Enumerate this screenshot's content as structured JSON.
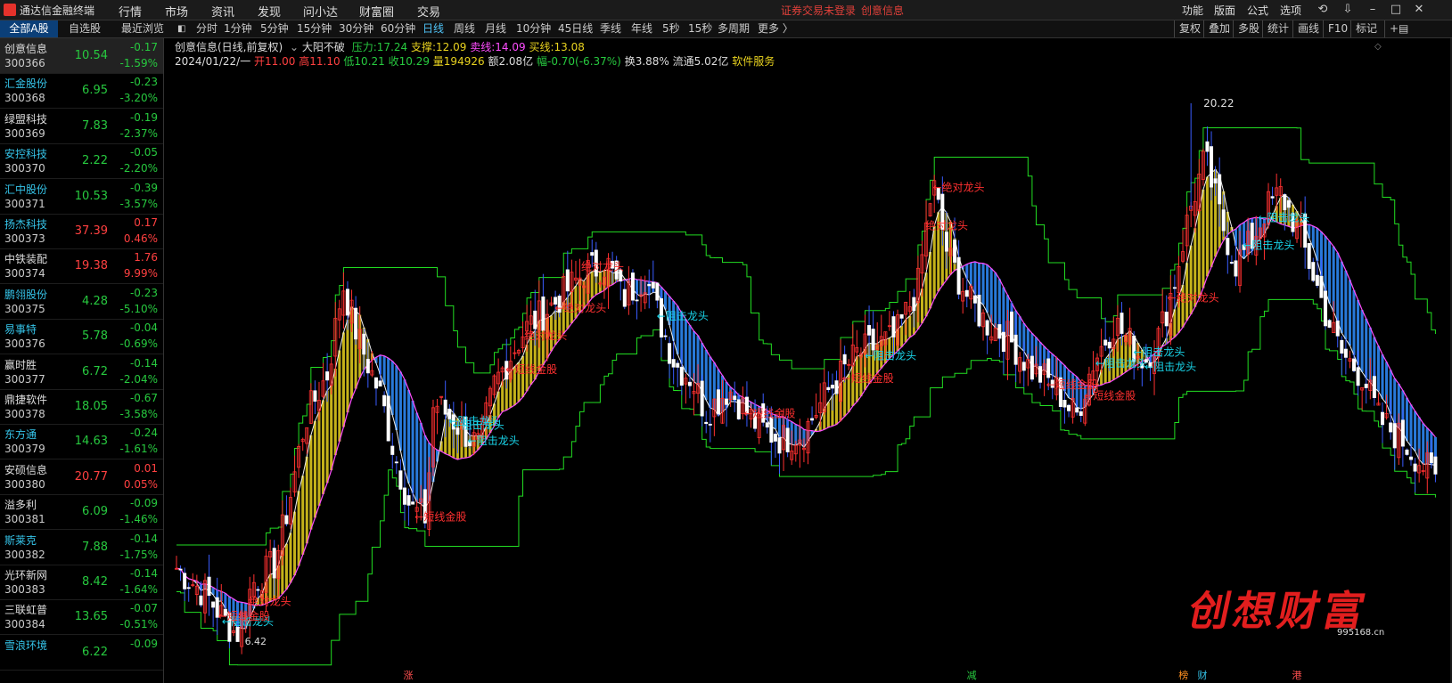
{
  "app": {
    "title": "通达信金融终端",
    "menus": [
      "行情",
      "市场",
      "资讯",
      "发现",
      "问小达",
      "财富圈",
      "交易"
    ],
    "status_login": "证券交易未登录",
    "status_stock": "创意信息",
    "right_menus": [
      "功能",
      "版面",
      "公式",
      "选项"
    ]
  },
  "list_tabs": [
    "全部A股",
    "自选股",
    "最近浏览"
  ],
  "period_tabs": [
    "分时",
    "1分钟",
    "5分钟",
    "15分钟",
    "30分钟",
    "60分钟",
    "日线",
    "周线",
    "月线",
    "10分钟",
    "45日线",
    "季线",
    "年线",
    "5秒",
    "15秒",
    "多周期",
    "更多 〉"
  ],
  "active_period": "日线",
  "right_tools": [
    "复权",
    "叠加",
    "多股",
    "统计",
    "画线",
    "F10",
    "标记"
  ],
  "stocks": [
    {
      "name": "创意信息",
      "code": "300366",
      "price": "10.54",
      "change": "-0.17",
      "pct": "-1.59%",
      "dir": "dn",
      "name_color": "#dddddd",
      "selected": true
    },
    {
      "name": "汇金股份",
      "code": "300368",
      "price": "6.95",
      "change": "-0.23",
      "pct": "-3.20%",
      "dir": "dn",
      "name_color": "#35c3e8"
    },
    {
      "name": "绿盟科技",
      "code": "300369",
      "price": "7.83",
      "change": "-0.19",
      "pct": "-2.37%",
      "dir": "dn",
      "name_color": "#dddddd"
    },
    {
      "name": "安控科技",
      "code": "300370",
      "price": "2.22",
      "change": "-0.05",
      "pct": "-2.20%",
      "dir": "dn",
      "name_color": "#35c3e8"
    },
    {
      "name": "汇中股份",
      "code": "300371",
      "price": "10.53",
      "change": "-0.39",
      "pct": "-3.57%",
      "dir": "dn",
      "name_color": "#35c3e8"
    },
    {
      "name": "扬杰科技",
      "code": "300373",
      "price": "37.39",
      "change": "0.17",
      "pct": "0.46%",
      "dir": "up",
      "name_color": "#35c3e8"
    },
    {
      "name": "中铁装配",
      "code": "300374",
      "price": "19.38",
      "change": "1.76",
      "pct": "9.99%",
      "dir": "up",
      "name_color": "#dddddd"
    },
    {
      "name": "鹏翎股份",
      "code": "300375",
      "price": "4.28",
      "change": "-0.23",
      "pct": "-5.10%",
      "dir": "dn",
      "name_color": "#35c3e8"
    },
    {
      "name": "易事特",
      "code": "300376",
      "price": "5.78",
      "change": "-0.04",
      "pct": "-0.69%",
      "dir": "dn",
      "name_color": "#35c3e8"
    },
    {
      "name": "赢时胜",
      "code": "300377",
      "price": "6.72",
      "change": "-0.14",
      "pct": "-2.04%",
      "dir": "dn",
      "name_color": "#dddddd"
    },
    {
      "name": "鼎捷软件",
      "code": "300378",
      "price": "18.05",
      "change": "-0.67",
      "pct": "-3.58%",
      "dir": "dn",
      "name_color": "#dddddd"
    },
    {
      "name": "东方通",
      "code": "300379",
      "price": "14.63",
      "change": "-0.24",
      "pct": "-1.61%",
      "dir": "dn",
      "name_color": "#35c3e8"
    },
    {
      "name": "安硕信息",
      "code": "300380",
      "price": "20.77",
      "change": "0.01",
      "pct": "0.05%",
      "dir": "up",
      "name_color": "#dddddd"
    },
    {
      "name": "溢多利",
      "code": "300381",
      "price": "6.09",
      "change": "-0.09",
      "pct": "-1.46%",
      "dir": "dn",
      "name_color": "#dddddd"
    },
    {
      "name": "斯莱克",
      "code": "300382",
      "price": "7.88",
      "change": "-0.14",
      "pct": "-1.75%",
      "dir": "dn",
      "name_color": "#35c3e8"
    },
    {
      "name": "光环新网",
      "code": "300383",
      "price": "8.42",
      "change": "-0.14",
      "pct": "-1.64%",
      "dir": "dn",
      "name_color": "#dddddd"
    },
    {
      "name": "三联虹普",
      "code": "300384",
      "price": "13.65",
      "change": "-0.07",
      "pct": "-0.51%",
      "dir": "dn",
      "name_color": "#dddddd"
    },
    {
      "name": "雪浪环境",
      "code": "",
      "price": "6.22",
      "change": "-0.09",
      "pct": "",
      "dir": "dn",
      "name_color": "#35c3e8"
    }
  ],
  "chart_header": {
    "name": "创意信息(日线,前复权)",
    "indicator": "大阳不破",
    "pressure_label": "压力:",
    "pressure": "17.24",
    "support_label": "支撑:",
    "support": "12.09",
    "sell_label": "卖线:",
    "sell": "14.09",
    "buy_label": "买线:",
    "buy": "13.08",
    "date": "2024/01/22/一",
    "open": "开11.00",
    "high": "高11.10",
    "low": "低10.21",
    "close": "收10.29",
    "volume": "量194926",
    "amount": "额2.08亿",
    "amplitude": "幅-0.70(-6.37%)",
    "turnover": "换3.88%",
    "float": "流通5.02亿",
    "sector": "软件服务"
  },
  "chart_labels": {
    "high_mark": "20.22",
    "low_mark": "6.42",
    "signals": [
      {
        "text": "←阻击龙头",
        "color": "#19d3e8",
        "xi": 12,
        "yp": 0.33
      },
      {
        "text": "绝对龙头",
        "color": "#ff3030",
        "xi": 19,
        "yp": 0.36
      },
      {
        "text": "←短线金股",
        "color": "#ff3030",
        "xi": 11,
        "yp": 0.03
      },
      {
        "text": "←短线金股",
        "color": "#ff3030",
        "xi": 63,
        "yp": 1.05
      },
      {
        "text": "←阻击龙头",
        "color": "#19d3e8",
        "xi": 72,
        "yp": 2.05
      },
      {
        "text": "←阻击龙头",
        "color": "#19d3e8",
        "xi": 73,
        "yp": 2.35
      },
      {
        "text": "←阻击龙头",
        "color": "#19d3e8",
        "xi": 77,
        "yp": 2.65
      },
      {
        "text": "←短线金股",
        "color": "#ff3030",
        "xi": 87,
        "yp": 3.5
      },
      {
        "text": "绝对龙头",
        "color": "#ff3030",
        "xi": 92,
        "yp": 4.3
      },
      {
        "text": "←绝对龙头",
        "color": "#ff3030",
        "xi": 100,
        "yp": 3.8
      },
      {
        "text": "绝对龙头",
        "color": "#ff3030",
        "xi": 107,
        "yp": 5.6
      },
      {
        "text": "←阻击龙头",
        "color": "#19d3e8",
        "xi": 127,
        "yp": 3.35
      },
      {
        "text": "←短线金股",
        "color": "#ff3030",
        "xi": 150,
        "yp": 1.55
      },
      {
        "text": "←短线金股",
        "color": "#ff3030",
        "xi": 176,
        "yp": 1.65
      },
      {
        "text": "←阻击龙头",
        "color": "#19d3e8",
        "xi": 182,
        "yp": 2.2
      },
      {
        "text": "绝对龙头",
        "color": "#ff3030",
        "xi": 198,
        "yp": 6.5
      },
      {
        "text": "←绝对龙头",
        "color": "#ff3030",
        "xi": 200,
        "yp": 4.7
      },
      {
        "text": "←短线金股",
        "color": "#ff3030",
        "xi": 230,
        "yp": 2.6
      },
      {
        "text": "←短线金股",
        "color": "#ff3030",
        "xi": 240,
        "yp": 2.7
      },
      {
        "text": "←阻击龙头",
        "color": "#19d3e8",
        "xi": 243,
        "yp": 2.95
      },
      {
        "text": "←阻击龙头",
        "color": "#19d3e8",
        "xi": 253,
        "yp": 2.75
      },
      {
        "text": "←阻击龙头",
        "color": "#19d3e8",
        "xi": 256,
        "yp": 3.35
      },
      {
        "text": "←绝对龙头",
        "color": "#ff3030",
        "xi": 262,
        "yp": 7.3
      },
      {
        "text": "←阻击龙头",
        "color": "#19d3e8",
        "xi": 282,
        "yp": 9.1
      },
      {
        "text": "←阻击龙头",
        "color": "#19d3e8",
        "xi": 286,
        "yp": 8.5
      }
    ],
    "bottom_marks": [
      {
        "text": "涨",
        "color": "#ff5050",
        "xi": 60
      },
      {
        "text": "减",
        "color": "#27c93f",
        "xi": 209
      },
      {
        "text": "榜",
        "color": "#ff9020",
        "xi": 265
      },
      {
        "text": "财",
        "color": "#35c3e8",
        "xi": 270
      },
      {
        "text": "港",
        "color": "#ff5050",
        "xi": 295
      }
    ]
  },
  "watermark": {
    "text": "创想财富",
    "site": "995168.cn"
  },
  "colors": {
    "up": "#ff4040",
    "down": "#27c93f",
    "cyan": "#35c3e8",
    "yellow": "#e8d21f",
    "blue": "#2f8fff",
    "green_line": "#22dd22"
  }
}
